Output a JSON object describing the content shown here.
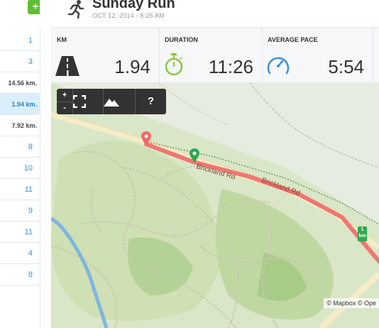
{
  "sidebar": {
    "add_label": "+",
    "items": [
      {
        "label": "1"
      },
      {
        "label": "3"
      },
      {
        "label": "14.56 km."
      },
      {
        "label": "1.94 km."
      },
      {
        "label": "7.92 km."
      },
      {
        "label": "8"
      },
      {
        "label": "10"
      },
      {
        "label": "11"
      },
      {
        "label": "9"
      },
      {
        "label": "11"
      },
      {
        "label": "4"
      },
      {
        "label": "8"
      }
    ]
  },
  "header": {
    "title": "Sunday Run",
    "subtitle": "OCT 12, 2014  -  8:26 AM"
  },
  "stats": [
    {
      "label": "KM",
      "value": "1.94",
      "icon": "road-icon"
    },
    {
      "label": "DURATION",
      "value": "11:26",
      "icon": "stopwatch-icon"
    },
    {
      "label": "AVERAGE PACE",
      "value": "5:54",
      "icon": "speedometer-icon"
    }
  ],
  "map": {
    "controls": {
      "zoom_in": "+",
      "zoom_out": "-",
      "help": "?"
    },
    "road_labels": [
      "Brickland Rd",
      "Brickland Rd"
    ],
    "km_marker": {
      "number": "1",
      "unit": "km"
    },
    "attribution": "© Mapbox © Ope"
  },
  "colors": {
    "accent": "#3b93d6",
    "route": "#f26868",
    "add_button": "#5cbd32",
    "icon_green": "#8cc63f"
  }
}
